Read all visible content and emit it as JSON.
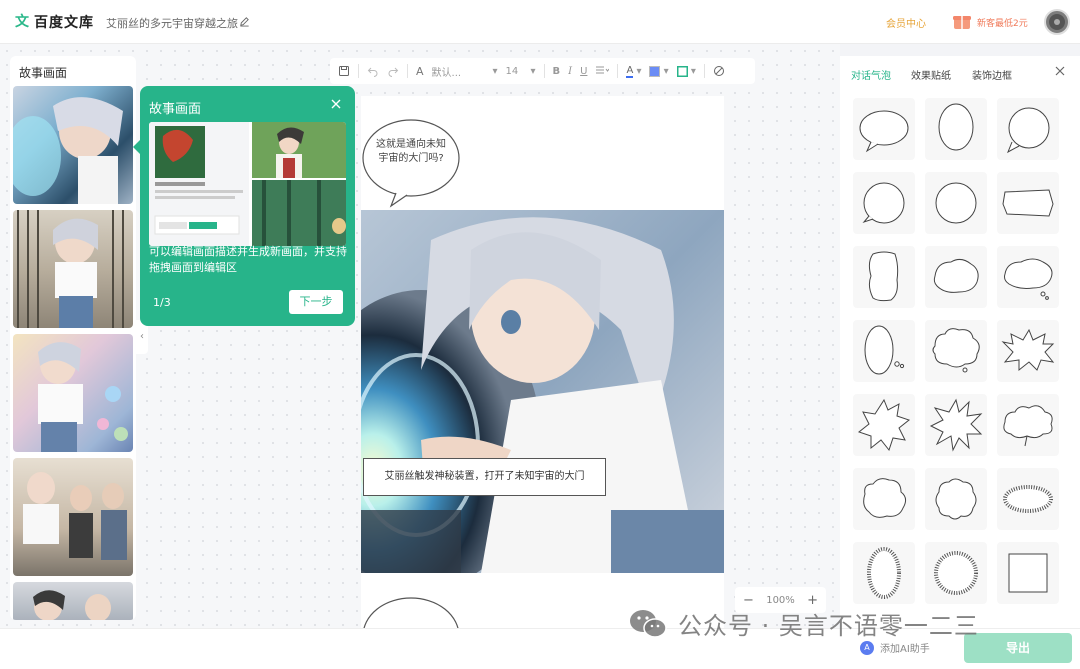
{
  "header": {
    "logo_mark": "文",
    "logo_text": "百度文库",
    "doc_title": "艾丽丝的多元宇宙穿越之旅",
    "vip_label": "会员中心",
    "promo_label": "新客最低2元"
  },
  "toolbar": {
    "font_placeholder": "默认...",
    "font_size": "14",
    "bold": "B",
    "italic": "I",
    "underline": "U",
    "text_color": "A"
  },
  "left_panel": {
    "title": "故事画面",
    "collapse": "‹"
  },
  "guide": {
    "title": "故事画面",
    "description": "可以编辑画面描述并生成新画面，并支持拖拽画面到编辑区",
    "step": "1/3",
    "next_label": "下一步"
  },
  "canvas": {
    "bubble_text": "这就是通向未知宇宙的大门吗?",
    "caption": "艾丽丝触发神秘装置，打开了未知宇宙的大门"
  },
  "zoom": {
    "minus": "−",
    "level": "100%",
    "plus": "+"
  },
  "right_panel": {
    "tabs": [
      "对话气泡",
      "效果贴纸",
      "装饰边框"
    ],
    "active_tab": 0
  },
  "bottom": {
    "ai_label": "添加AI助手",
    "export_label": "导出"
  },
  "watermark": {
    "text": "公众号 · 吴言不语零一二三"
  },
  "colors": {
    "accent": "#27b48a",
    "vip": "#e7a53a",
    "promo": "#f07a5a"
  }
}
